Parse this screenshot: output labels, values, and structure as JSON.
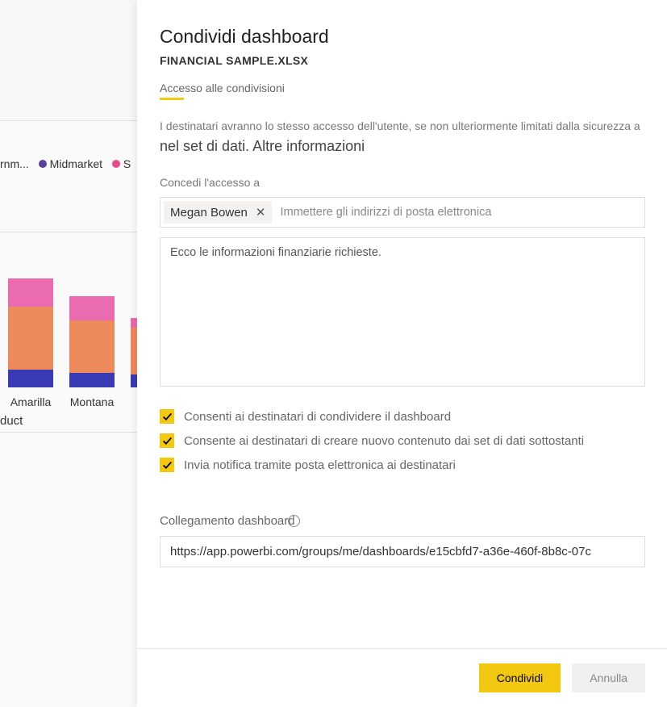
{
  "background": {
    "legend": {
      "item1_partial": "rnm...",
      "item2": "Midmarket",
      "item3_partial": "S",
      "color1": "#5a3e9e",
      "color2": "#5a3e9e",
      "color3": "#ea4c89"
    },
    "bars": [
      {
        "label": "Amarilla",
        "segs": [
          {
            "h": 22,
            "c": "#3a3ab5"
          },
          {
            "h": 78,
            "c": "#ed8a5c"
          },
          {
            "h": 35,
            "c": "#ea6bb0"
          }
        ]
      },
      {
        "label": "Montana",
        "segs": [
          {
            "h": 18,
            "c": "#3a3ab5"
          },
          {
            "h": 65,
            "c": "#ed8a5c"
          },
          {
            "h": 30,
            "c": "#ea6bb0"
          }
        ]
      },
      {
        "label": "",
        "segs": [
          {
            "h": 16,
            "c": "#3a3ab5"
          },
          {
            "h": 58,
            "c": "#ed8a5c"
          },
          {
            "h": 12,
            "c": "#ea6bb0"
          }
        ]
      }
    ],
    "axis_label": "duct"
  },
  "panel": {
    "title": "Condividi dashboard",
    "subtitle": "FINANCIAL SAMPLE.XLSX",
    "tab": "Accesso alle condivisioni",
    "description": "I destinatari avranno lo stesso accesso dell'utente, se non ulteriormente limitati dalla sicurezza a",
    "description_link": "nel set di dati. Altre informazioni",
    "grant_label": "Concedi l'accesso a",
    "recipient_chip": "Megan Bowen",
    "recipient_placeholder": "Immettere gli indirizzi di posta elettronica",
    "message_value": "Ecco le informazioni finanziarie richieste.",
    "checks": [
      "Consenti ai destinatari di condividere il dashboard",
      "Consente ai destinatari di creare nuovo contenuto dai set di dati sottostanti",
      "Invia notifica tramite posta elettronica ai destinatari"
    ],
    "link_label": "Collegamento dashboard",
    "info_glyph": "i",
    "link_value": "https://app.powerbi.com/groups/me/dashboards/e15cbfd7-a36e-460f-8b8c-07c",
    "share_btn": "Condividi",
    "cancel_btn": "Annulla"
  }
}
